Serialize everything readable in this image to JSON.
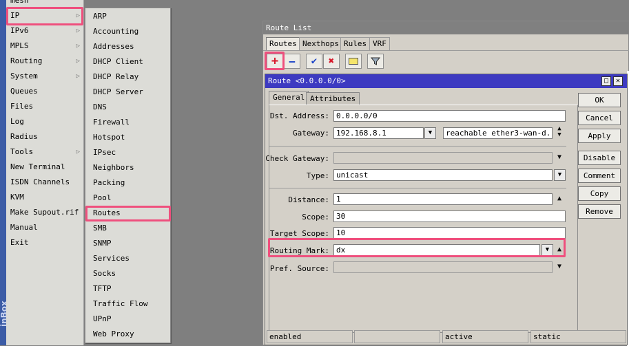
{
  "left_strip": {
    "brand": "inBox"
  },
  "main_menu": {
    "items": [
      {
        "label": "mesh",
        "has_submenu": false
      },
      {
        "label": "IP",
        "has_submenu": true
      },
      {
        "label": "IPv6",
        "has_submenu": true
      },
      {
        "label": "MPLS",
        "has_submenu": true
      },
      {
        "label": "Routing",
        "has_submenu": true
      },
      {
        "label": "System",
        "has_submenu": true
      },
      {
        "label": "Queues",
        "has_submenu": false
      },
      {
        "label": "Files",
        "has_submenu": false
      },
      {
        "label": "Log",
        "has_submenu": false
      },
      {
        "label": "Radius",
        "has_submenu": false
      },
      {
        "label": "Tools",
        "has_submenu": true
      },
      {
        "label": "New Terminal",
        "has_submenu": false
      },
      {
        "label": "ISDN Channels",
        "has_submenu": false
      },
      {
        "label": "KVM",
        "has_submenu": false
      },
      {
        "label": "Make Supout.rif",
        "has_submenu": false
      },
      {
        "label": "Manual",
        "has_submenu": false
      },
      {
        "label": "Exit",
        "has_submenu": false
      }
    ],
    "submenu_arrow": "▷"
  },
  "ip_submenu": {
    "items": [
      "ARP",
      "Accounting",
      "Addresses",
      "DHCP Client",
      "DHCP Relay",
      "DHCP Server",
      "DNS",
      "Firewall",
      "Hotspot",
      "IPsec",
      "Neighbors",
      "Packing",
      "Pool",
      "Routes",
      "SMB",
      "SNMP",
      "Services",
      "Socks",
      "TFTP",
      "Traffic Flow",
      "UPnP",
      "Web Proxy"
    ],
    "selected": "Routes"
  },
  "route_list": {
    "title": "Route List",
    "tabs": [
      "Routes",
      "Nexthops",
      "Rules",
      "VRF"
    ],
    "active_tab": "Routes",
    "toolbar": {
      "add": "+",
      "remove": "−",
      "enable": "✔",
      "disable": "✖",
      "comment": "▭",
      "filter": "⏷"
    }
  },
  "route_dialog": {
    "title": "Route <0.0.0.0/0>",
    "tabs": [
      "General",
      "Attributes"
    ],
    "active_tab": "General",
    "window_buttons": {
      "restore": "□",
      "close": "✕"
    },
    "fields": {
      "dst_address": {
        "label": "Dst. Address:",
        "value": "0.0.0.0/0"
      },
      "gateway": {
        "label": "Gateway:",
        "value": "192.168.8.1",
        "status": "reachable ether3-wan-d..."
      },
      "check_gateway": {
        "label": "Check Gateway:",
        "value": ""
      },
      "type": {
        "label": "Type:",
        "value": "unicast"
      },
      "distance": {
        "label": "Distance:",
        "value": "1"
      },
      "scope": {
        "label": "Scope:",
        "value": "30"
      },
      "target_scope": {
        "label": "Target Scope:",
        "value": "10"
      },
      "routing_mark": {
        "label": "Routing Mark:",
        "value": "dx"
      },
      "pref_source": {
        "label": "Pref. Source:",
        "value": ""
      }
    },
    "buttons": {
      "ok": "OK",
      "cancel": "Cancel",
      "apply": "Apply",
      "disable": "Disable",
      "comment": "Comment",
      "copy": "Copy",
      "remove": "Remove"
    },
    "status_bar": [
      "enabled",
      "",
      "active",
      "static"
    ]
  },
  "colors": {
    "highlight": "#ef4f7d",
    "dialog_title": "#3d3ac1",
    "add_icon": "#d7192b",
    "check_icon": "#1d45c7"
  }
}
